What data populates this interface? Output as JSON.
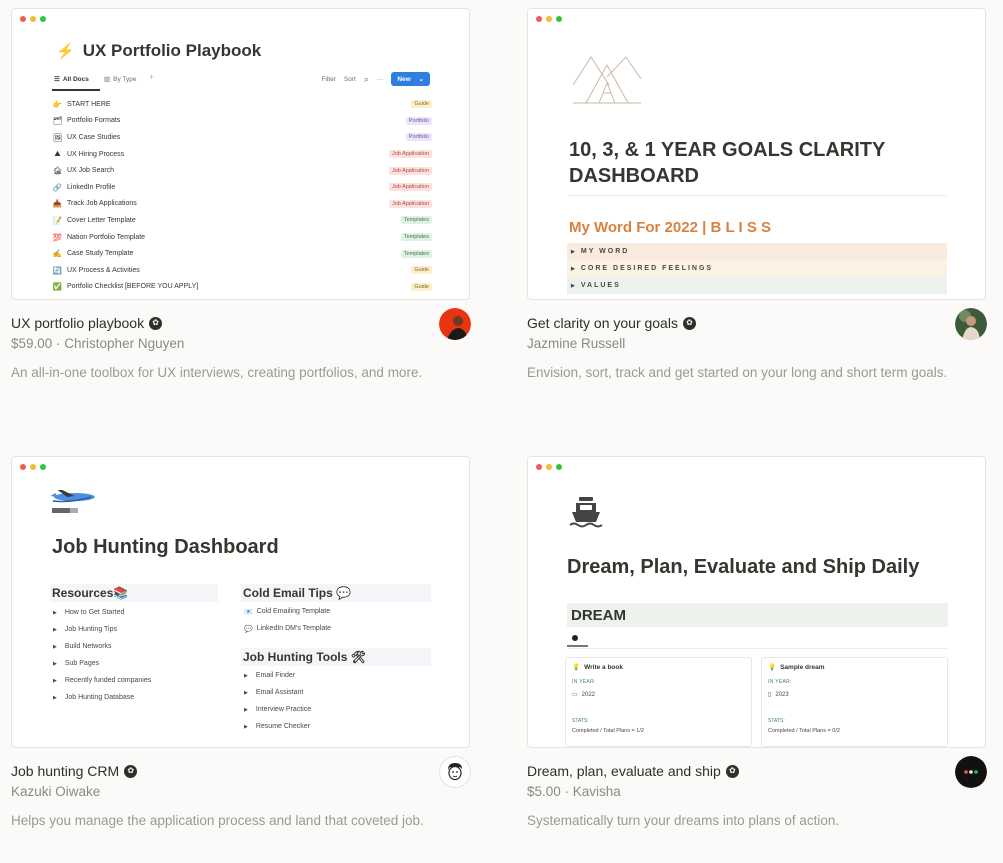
{
  "templates": [
    {
      "name": "UX portfolio playbook",
      "byline": "$59.00 · Christopher Nguyen",
      "description": "An all-in-one toolbox for UX interviews, creating portfolios, and more.",
      "avatar_color": "#e8340f",
      "preview": {
        "title": "UX Portfolio Playbook",
        "title_icon": "lightning-bolt-icon",
        "tabs": [
          {
            "label": "All Docs",
            "icon": "list-icon",
            "active": true
          },
          {
            "label": "By Type",
            "icon": "board-icon",
            "active": false
          }
        ],
        "add_tab": "+",
        "toolbar": {
          "filter": "Filter",
          "sort": "Sort",
          "search_icon": "⌕",
          "more": "···",
          "new": "New",
          "new_dropdown": "⌄"
        },
        "rows": [
          {
            "emoji": "👉",
            "label": "START HERE",
            "tag": "Guide",
            "tag_bg": "#fbefcc",
            "tag_fg": "#8a6a20"
          },
          {
            "emoji": "🗂",
            "label": "Portfolio Formats",
            "tag": "Portfolio",
            "tag_bg": "#ebe4fa",
            "tag_fg": "#6a4fb0"
          },
          {
            "emoji": "🖼",
            "label": "UX Case Studies",
            "tag": "Portfolio",
            "tag_bg": "#ebe4fa",
            "tag_fg": "#6a4fb0"
          },
          {
            "emoji": "⛰",
            "label": "UX Hiring Process",
            "tag": "Job Application",
            "tag_bg": "#fbe1df",
            "tag_fg": "#b04a43"
          },
          {
            "emoji": "🏚",
            "label": "UX Job Search",
            "tag": "Job Application",
            "tag_bg": "#fbe1df",
            "tag_fg": "#b04a43"
          },
          {
            "emoji": "🔗",
            "label": "LinkedIn Profile",
            "tag": "Job Application",
            "tag_bg": "#fbe1df",
            "tag_fg": "#b04a43"
          },
          {
            "emoji": "📥",
            "label": "Track Job Applications",
            "tag": "Job Application",
            "tag_bg": "#fbe1df",
            "tag_fg": "#b04a43"
          },
          {
            "emoji": "📝",
            "label": "Cover Letter Template",
            "tag": "Templates",
            "tag_bg": "#e2f0e3",
            "tag_fg": "#3f7a4a"
          },
          {
            "emoji": "💯",
            "label": "Nation Portfolio Template",
            "tag": "Templates",
            "tag_bg": "#e2f0e3",
            "tag_fg": "#3f7a4a"
          },
          {
            "emoji": "✍",
            "label": "Case Study Template",
            "tag": "Templates",
            "tag_bg": "#e2f0e3",
            "tag_fg": "#3f7a4a"
          },
          {
            "emoji": "🔄",
            "label": "UX Process & Activities",
            "tag": "Guide",
            "tag_bg": "#fbefcc",
            "tag_fg": "#8a6a20"
          },
          {
            "emoji": "✅",
            "label": "Portfolio Checklist [BEFORE YOU APPLY]",
            "tag": "Guide",
            "tag_bg": "#fbefcc",
            "tag_fg": "#8a6a20"
          }
        ]
      }
    },
    {
      "name": "Get clarity on your goals",
      "byline": "Jazmine Russell",
      "description": "Envision, sort, track and get started on your long and short term goals.",
      "avatar_color": "#3d5a3a",
      "preview": {
        "logo_icon": "mountains-icon",
        "title": "10, 3, & 1 YEAR GOALS CLARITY DASHBOARD",
        "word_heading": "My Word For 2022 | B L I S S",
        "accent": "#d9813f",
        "toggles": [
          {
            "label": "MY WORD",
            "bg": "#faebe1"
          },
          {
            "label": "CORE DESIRED FEELINGS",
            "bg": "#fbf3e1"
          },
          {
            "label": "VALUES",
            "bg": "#ecf1ed"
          }
        ]
      }
    },
    {
      "name": "Job hunting CRM",
      "byline": "Kazuki Oiwake",
      "description": "Helps you manage the application process and land that coveted job.",
      "avatar_color": "#ffffff",
      "preview": {
        "icon": "airplane-icon",
        "icon_glyph": "✈",
        "title": "Job Hunting Dashboard",
        "resources": {
          "heading": "Resources📚",
          "items": [
            "How to Get Started",
            "Job Hunting Tips",
            "Build Networks",
            "Sub Pages",
            "Recently funded companies",
            "Job Hunting Database"
          ]
        },
        "cold_email": {
          "heading": "Cold Email Tips 💬",
          "items": [
            {
              "icon": "📧",
              "label": "Cold Emailing Template"
            },
            {
              "icon": "💬",
              "label": "LinkedIn DM's Template"
            }
          ]
        },
        "tools": {
          "heading": "Job Hunting Tools 🛠",
          "items": [
            "Email Finder",
            "Email Assistant",
            "Interview Practice",
            "Resume Checker"
          ]
        }
      }
    },
    {
      "name": "Dream, plan, evaluate and ship",
      "byline": "$5.00 · Kavisha",
      "description": "Systematically turn your dreams into plans of action.",
      "avatar_color": "#111111",
      "preview": {
        "icon": "ship-icon",
        "title": "Dream, Plan, Evaluate and Ship Daily",
        "section": "DREAM",
        "cards": [
          {
            "title": "Write a book",
            "year_label": "IN YEAR:",
            "year_icon": "▭",
            "year": "2022",
            "stats_label": "STATS:",
            "stats": "Completed / Total Plans = 1/2"
          },
          {
            "title": "Sample dream",
            "year_label": "IN YEAR:",
            "year_icon": "▯",
            "year": "2023",
            "stats_label": "STATS:",
            "stats": "Completed / Total Plans = 0/2"
          }
        ]
      }
    }
  ],
  "common": {
    "featured_badge": "✿",
    "toggle_arrow": "▶",
    "bulb_icon": "♡"
  }
}
